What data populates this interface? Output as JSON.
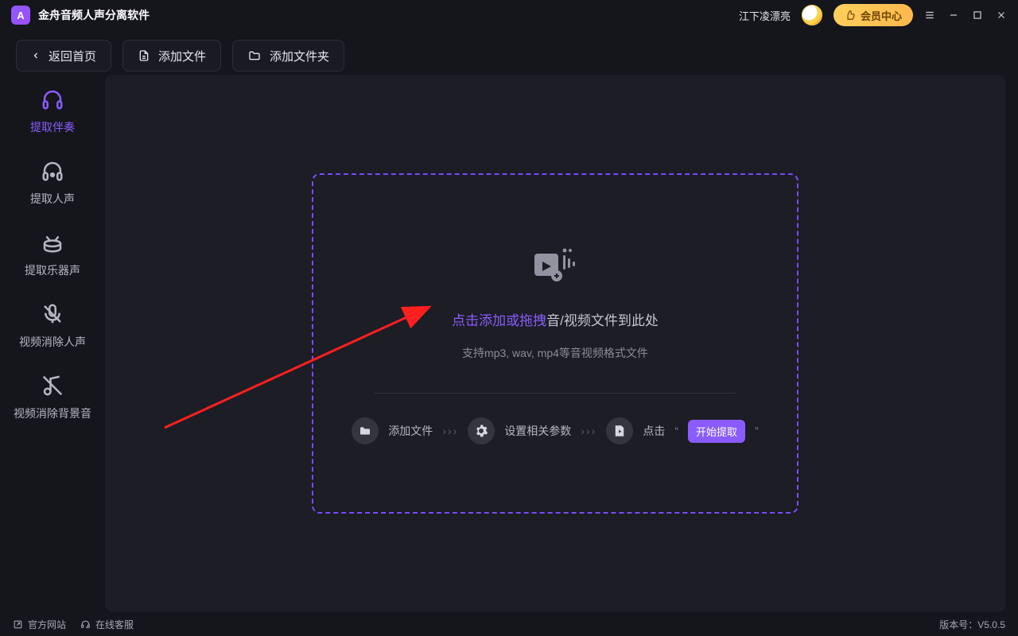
{
  "app": {
    "title": "金舟音频人声分离软件",
    "logo_letter": "A"
  },
  "header": {
    "username": "江下凌漂亮",
    "vip_label": "会员中心"
  },
  "toolbar": {
    "back_label": "返回首页",
    "add_file_label": "添加文件",
    "add_folder_label": "添加文件夹"
  },
  "sidebar": {
    "items": [
      {
        "label": "提取伴奏"
      },
      {
        "label": "提取人声"
      },
      {
        "label": "提取乐器声"
      },
      {
        "label": "视频消除人声"
      },
      {
        "label": "视频消除背景音"
      }
    ]
  },
  "dropzone": {
    "line_accent": "点击添加或拖拽",
    "line_rest": "音/视频文件到此处",
    "subtext": "支持mp3, wav, mp4等音视频格式文件",
    "step1": "添加文件",
    "step2": "设置相关参数",
    "step3_prefix": "点击",
    "start_label": "开始提取"
  },
  "footer": {
    "site_label": "官方网站",
    "support_label": "在线客服",
    "version_prefix": "版本号：",
    "version": "V5.0.5"
  }
}
